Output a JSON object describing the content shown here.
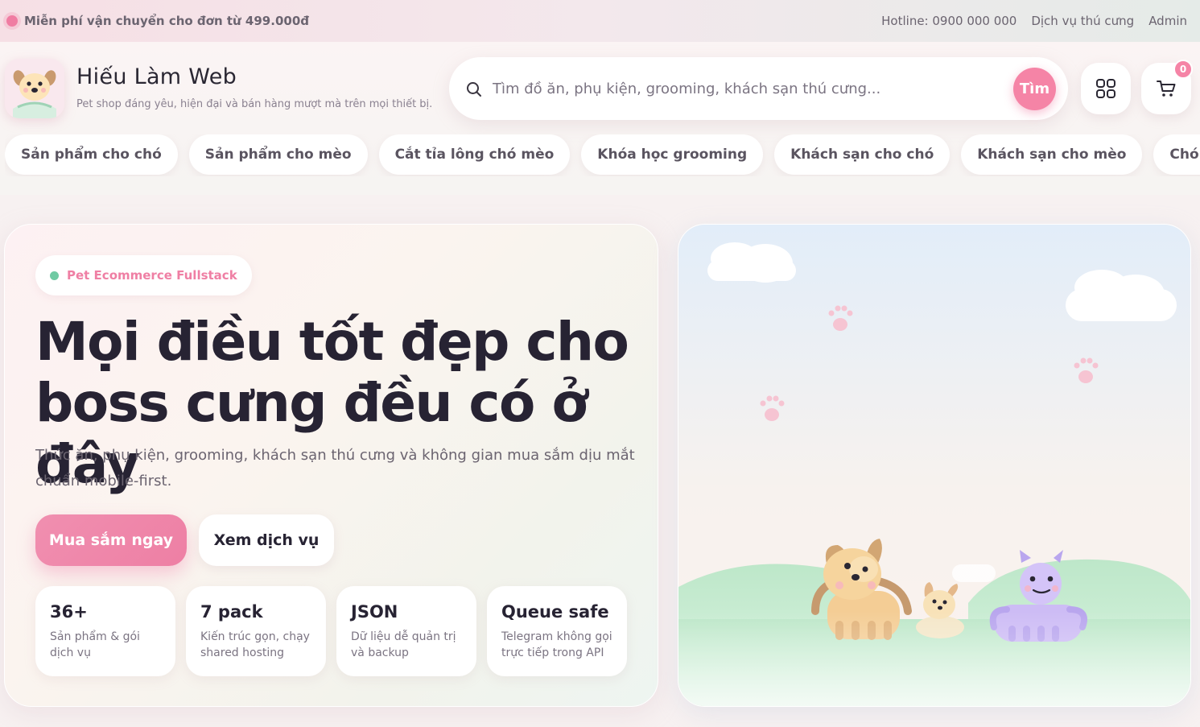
{
  "announcement": {
    "promo_text": "Miễn phí vận chuyển cho đơn từ 499.000đ",
    "links": [
      "Hotline: 0900 000 000",
      "Dịch vụ thú cưng",
      "Admin"
    ]
  },
  "brand": {
    "name": "Hiếu Làm Web",
    "tagline": "Pet shop đáng yêu, hiện đại và bán hàng mượt mà trên mọi thiết bị."
  },
  "search": {
    "placeholder": "Tìm đồ ăn, phụ kiện, grooming, khách sạn thú cưng...",
    "button_label": "Tìm"
  },
  "header_icons": {
    "grid_icon": "grid-icon",
    "cart_icon": "cart-icon",
    "cart_count": "0"
  },
  "categories": [
    "Sản phẩm cho chó",
    "Sản phẩm cho mèo",
    "Cắt tỉa lông chó mèo",
    "Khóa học grooming",
    "Khách sạn cho chó",
    "Khách sạn cho mèo",
    "Chó mèo tìm sen"
  ],
  "hero": {
    "badge": "Pet Ecommerce Fullstack",
    "title_line1": "Mọi điều tốt đẹp cho",
    "title_line2": "boss cưng đều có ở đây",
    "subtitle": "Thức ăn, phụ kiện, grooming, khách sạn thú cưng và không gian mua sắm dịu mắt chuẩn mobile-first.",
    "primary_button": "Mua sắm ngay",
    "secondary_button": "Xem dịch vụ",
    "stats": [
      {
        "value": "36+",
        "desc": "Sản phẩm & gói dịch vụ"
      },
      {
        "value": "7 pack",
        "desc": "Kiến trúc gọn, chạy shared hosting"
      },
      {
        "value": "JSON",
        "desc": "Dữ liệu dễ quản trị và backup"
      },
      {
        "value": "Queue safe",
        "desc": "Telegram không gọi trực tiếp trong API"
      }
    ]
  },
  "colors": {
    "accent_pink": "#f584a6",
    "accent_green": "#6fcaa3",
    "text_dark": "#272333"
  }
}
